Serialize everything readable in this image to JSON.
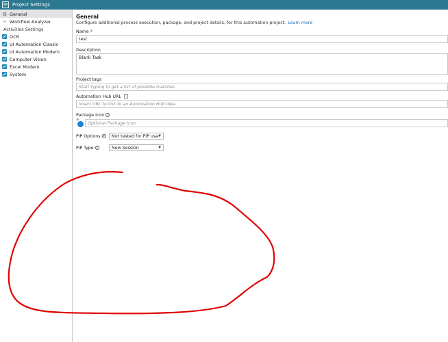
{
  "window": {
    "title": "Project Settings",
    "app_icon": "UI"
  },
  "sidebar": {
    "top_items": [
      {
        "label": "General",
        "icon": "gear-icon",
        "selected": true
      },
      {
        "label": "Workflow Analyzer",
        "icon": "workflow-icon",
        "selected": false
      }
    ],
    "section_label": "Activities Settings",
    "activity_items": [
      {
        "label": "OCR"
      },
      {
        "label": "UI Automation Classic"
      },
      {
        "label": "UI Automation Modern"
      },
      {
        "label": "Computer Vision"
      },
      {
        "label": "Excel Modern"
      },
      {
        "label": "System"
      }
    ]
  },
  "main": {
    "title": "General",
    "description": "Configure additional process execution, package, and project details, for this automation project.",
    "learn_more": "Learn more",
    "name_label": "Name",
    "name_required": "*",
    "name_value": "test",
    "description_label": "Description",
    "description_value": "Blank Task",
    "tags_label": "Project tags",
    "tags_placeholder": "Start typing to get a list of possible matches",
    "hub_label": "Automation Hub URL",
    "hub_placeholder": "Insert URL to link to an Automation Hub Idea",
    "package_icon_label": "Package Icon",
    "package_icon_placeholder": "Optional Package Icon",
    "pip_options_label": "PiP Options",
    "pip_options_value": "Not tested for PiP usage",
    "pip_type_label": "PiP Type",
    "pip_type_value": "New Session"
  },
  "colors": {
    "titlebar": "#2c7891",
    "accent": "#2a8bb0",
    "link": "#1a6fb5",
    "annotation_stroke": "#e00000"
  }
}
